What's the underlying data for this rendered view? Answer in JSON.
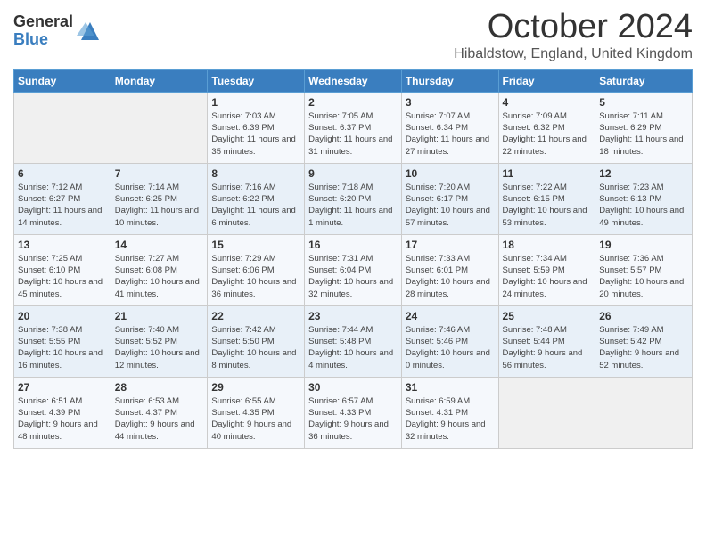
{
  "logo": {
    "general": "General",
    "blue": "Blue"
  },
  "title": "October 2024",
  "subtitle": "Hibaldstow, England, United Kingdom",
  "days_of_week": [
    "Sunday",
    "Monday",
    "Tuesday",
    "Wednesday",
    "Thursday",
    "Friday",
    "Saturday"
  ],
  "weeks": [
    [
      {
        "day": "",
        "info": ""
      },
      {
        "day": "",
        "info": ""
      },
      {
        "day": "1",
        "info": "Sunrise: 7:03 AM\nSunset: 6:39 PM\nDaylight: 11 hours and 35 minutes."
      },
      {
        "day": "2",
        "info": "Sunrise: 7:05 AM\nSunset: 6:37 PM\nDaylight: 11 hours and 31 minutes."
      },
      {
        "day": "3",
        "info": "Sunrise: 7:07 AM\nSunset: 6:34 PM\nDaylight: 11 hours and 27 minutes."
      },
      {
        "day": "4",
        "info": "Sunrise: 7:09 AM\nSunset: 6:32 PM\nDaylight: 11 hours and 22 minutes."
      },
      {
        "day": "5",
        "info": "Sunrise: 7:11 AM\nSunset: 6:29 PM\nDaylight: 11 hours and 18 minutes."
      }
    ],
    [
      {
        "day": "6",
        "info": "Sunrise: 7:12 AM\nSunset: 6:27 PM\nDaylight: 11 hours and 14 minutes."
      },
      {
        "day": "7",
        "info": "Sunrise: 7:14 AM\nSunset: 6:25 PM\nDaylight: 11 hours and 10 minutes."
      },
      {
        "day": "8",
        "info": "Sunrise: 7:16 AM\nSunset: 6:22 PM\nDaylight: 11 hours and 6 minutes."
      },
      {
        "day": "9",
        "info": "Sunrise: 7:18 AM\nSunset: 6:20 PM\nDaylight: 11 hours and 1 minute."
      },
      {
        "day": "10",
        "info": "Sunrise: 7:20 AM\nSunset: 6:17 PM\nDaylight: 10 hours and 57 minutes."
      },
      {
        "day": "11",
        "info": "Sunrise: 7:22 AM\nSunset: 6:15 PM\nDaylight: 10 hours and 53 minutes."
      },
      {
        "day": "12",
        "info": "Sunrise: 7:23 AM\nSunset: 6:13 PM\nDaylight: 10 hours and 49 minutes."
      }
    ],
    [
      {
        "day": "13",
        "info": "Sunrise: 7:25 AM\nSunset: 6:10 PM\nDaylight: 10 hours and 45 minutes."
      },
      {
        "day": "14",
        "info": "Sunrise: 7:27 AM\nSunset: 6:08 PM\nDaylight: 10 hours and 41 minutes."
      },
      {
        "day": "15",
        "info": "Sunrise: 7:29 AM\nSunset: 6:06 PM\nDaylight: 10 hours and 36 minutes."
      },
      {
        "day": "16",
        "info": "Sunrise: 7:31 AM\nSunset: 6:04 PM\nDaylight: 10 hours and 32 minutes."
      },
      {
        "day": "17",
        "info": "Sunrise: 7:33 AM\nSunset: 6:01 PM\nDaylight: 10 hours and 28 minutes."
      },
      {
        "day": "18",
        "info": "Sunrise: 7:34 AM\nSunset: 5:59 PM\nDaylight: 10 hours and 24 minutes."
      },
      {
        "day": "19",
        "info": "Sunrise: 7:36 AM\nSunset: 5:57 PM\nDaylight: 10 hours and 20 minutes."
      }
    ],
    [
      {
        "day": "20",
        "info": "Sunrise: 7:38 AM\nSunset: 5:55 PM\nDaylight: 10 hours and 16 minutes."
      },
      {
        "day": "21",
        "info": "Sunrise: 7:40 AM\nSunset: 5:52 PM\nDaylight: 10 hours and 12 minutes."
      },
      {
        "day": "22",
        "info": "Sunrise: 7:42 AM\nSunset: 5:50 PM\nDaylight: 10 hours and 8 minutes."
      },
      {
        "day": "23",
        "info": "Sunrise: 7:44 AM\nSunset: 5:48 PM\nDaylight: 10 hours and 4 minutes."
      },
      {
        "day": "24",
        "info": "Sunrise: 7:46 AM\nSunset: 5:46 PM\nDaylight: 10 hours and 0 minutes."
      },
      {
        "day": "25",
        "info": "Sunrise: 7:48 AM\nSunset: 5:44 PM\nDaylight: 9 hours and 56 minutes."
      },
      {
        "day": "26",
        "info": "Sunrise: 7:49 AM\nSunset: 5:42 PM\nDaylight: 9 hours and 52 minutes."
      }
    ],
    [
      {
        "day": "27",
        "info": "Sunrise: 6:51 AM\nSunset: 4:39 PM\nDaylight: 9 hours and 48 minutes."
      },
      {
        "day": "28",
        "info": "Sunrise: 6:53 AM\nSunset: 4:37 PM\nDaylight: 9 hours and 44 minutes."
      },
      {
        "day": "29",
        "info": "Sunrise: 6:55 AM\nSunset: 4:35 PM\nDaylight: 9 hours and 40 minutes."
      },
      {
        "day": "30",
        "info": "Sunrise: 6:57 AM\nSunset: 4:33 PM\nDaylight: 9 hours and 36 minutes."
      },
      {
        "day": "31",
        "info": "Sunrise: 6:59 AM\nSunset: 4:31 PM\nDaylight: 9 hours and 32 minutes."
      },
      {
        "day": "",
        "info": ""
      },
      {
        "day": "",
        "info": ""
      }
    ]
  ]
}
